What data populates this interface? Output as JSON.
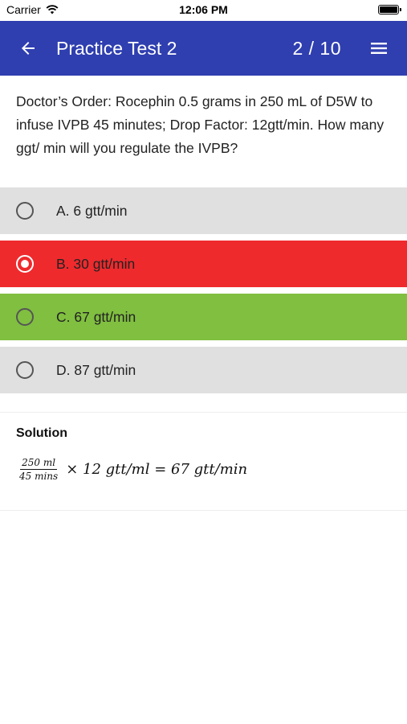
{
  "status_bar": {
    "carrier": "Carrier",
    "time": "12:06 PM",
    "icons": [
      "wifi-icon",
      "battery-icon"
    ]
  },
  "app_bar": {
    "title": "Practice Test 2",
    "progress": "2  / 10",
    "background": "#2f3fb0",
    "icons": [
      "arrow-left-icon",
      "hamburger-menu-icon"
    ]
  },
  "question": {
    "text": "Doctor’s Order: Rocephin 0.5 grams in 250 mL of D5W to infuse IVPB 45 minutes; Drop Factor: 12gtt/min. How many ggt/ min will you regulate the IVPB?"
  },
  "options": [
    {
      "label": "A. 6 gtt/min",
      "state": "neutral",
      "color": "#e0e0e0"
    },
    {
      "label": "B. 30 gtt/min",
      "state": "selected-incorrect",
      "color": "#ef2a2d"
    },
    {
      "label": "C. 67 gtt/min",
      "state": "correct",
      "color": "#80bf40"
    },
    {
      "label": "D. 87 gtt/min",
      "state": "neutral",
      "color": "#e0e0e0"
    }
  ],
  "solution": {
    "title": "Solution",
    "formula_numerator": "250 ml",
    "formula_denominator": "45 mins",
    "formula_rest": "× 12 gtt/ml = 67 gtt/min"
  }
}
